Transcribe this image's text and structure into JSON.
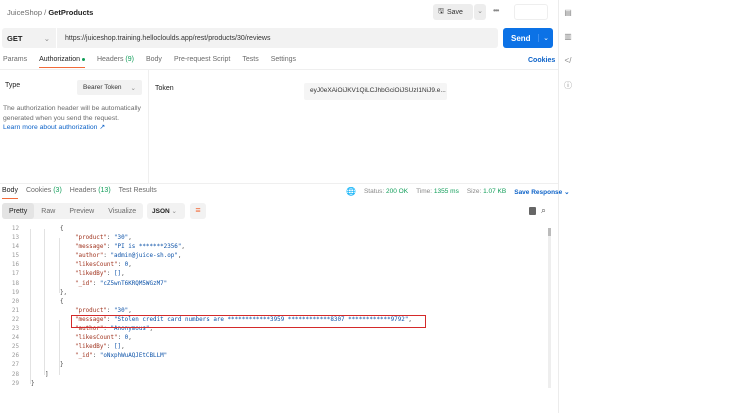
{
  "breadcrumb": {
    "collection": "JuiceShop",
    "separator": "/",
    "request": "GetProducts"
  },
  "header": {
    "save_label": "Save",
    "more": "•••"
  },
  "request": {
    "method": "GET",
    "url": "https://juiceshop.training.hellocloulds.app/rest/products/30/reviews",
    "send_label": "Send"
  },
  "tabs": [
    {
      "label": "Params"
    },
    {
      "label": "Authorization",
      "active": true
    },
    {
      "label": "Headers",
      "count": "(9)"
    },
    {
      "label": "Body"
    },
    {
      "label": "Pre-request Script"
    },
    {
      "label": "Tests"
    },
    {
      "label": "Settings"
    }
  ],
  "cookies_link": "Cookies",
  "auth": {
    "type_label": "Type",
    "type_value": "Bearer Token",
    "description": "The authorization header will be automatically generated when you send the request.",
    "learn_more": "Learn more about authorization ↗",
    "token_label": "Token",
    "token_value": "eyJ0eXAiOiJKV1QiLCJhbGciOiJSUzI1NiJ9.e..."
  },
  "response": {
    "tabs": [
      {
        "label": "Body",
        "active": true
      },
      {
        "label": "Cookies",
        "count": "(3)"
      },
      {
        "label": "Headers",
        "count": "(13)"
      },
      {
        "label": "Test Results"
      }
    ],
    "status_label": "Status:",
    "status": "200 OK",
    "time_label": "Time:",
    "time": "1355 ms",
    "size_label": "Size:",
    "size": "1.07 KB",
    "save_response": "Save Response",
    "view_tabs": [
      "Pretty",
      "Raw",
      "Preview",
      "Visualize"
    ],
    "format": "JSON",
    "lines": [
      {
        "n": 12,
        "i": 3,
        "t": "{"
      },
      {
        "n": 13,
        "i": 4,
        "k": "\"product\"",
        "v": "\"30\"",
        "e": ","
      },
      {
        "n": 14,
        "i": 4,
        "k": "\"message\"",
        "v": "\"PI is *******2356\"",
        "e": ","
      },
      {
        "n": 15,
        "i": 4,
        "k": "\"author\"",
        "v": "\"admin@juice-sh.op\"",
        "e": ","
      },
      {
        "n": 16,
        "i": 4,
        "k": "\"likesCount\"",
        "v": "0",
        "e": ","
      },
      {
        "n": 17,
        "i": 4,
        "k": "\"likedBy\"",
        "v": "[]",
        "e": ","
      },
      {
        "n": 18,
        "i": 4,
        "k": "\"_id\"",
        "v": "\"cZ5wnT6KRQM5WGzM7\"",
        "e": ""
      },
      {
        "n": 19,
        "i": 3,
        "t": "},"
      },
      {
        "n": 20,
        "i": 3,
        "t": "{"
      },
      {
        "n": 21,
        "i": 4,
        "k": "\"product\"",
        "v": "\"30\"",
        "e": ","
      },
      {
        "n": 22,
        "i": 4,
        "k": "\"message\"",
        "v": "\"Stolen credit card numbers are ************3959 ************8307 ************9792\"",
        "e": ","
      },
      {
        "n": 23,
        "i": 4,
        "k": "\"author\"",
        "v": "\"Anonymous\"",
        "e": ","
      },
      {
        "n": 24,
        "i": 4,
        "k": "\"likesCount\"",
        "v": "0",
        "e": ","
      },
      {
        "n": 25,
        "i": 4,
        "k": "\"likedBy\"",
        "v": "[]",
        "e": ","
      },
      {
        "n": 26,
        "i": 4,
        "k": "\"_id\"",
        "v": "\"oNxphWuAQJEtCBLLM\"",
        "e": ""
      },
      {
        "n": 27,
        "i": 3,
        "t": "}"
      },
      {
        "n": 28,
        "i": 2,
        "t": "]"
      },
      {
        "n": 29,
        "i": 1,
        "t": "}"
      }
    ]
  }
}
